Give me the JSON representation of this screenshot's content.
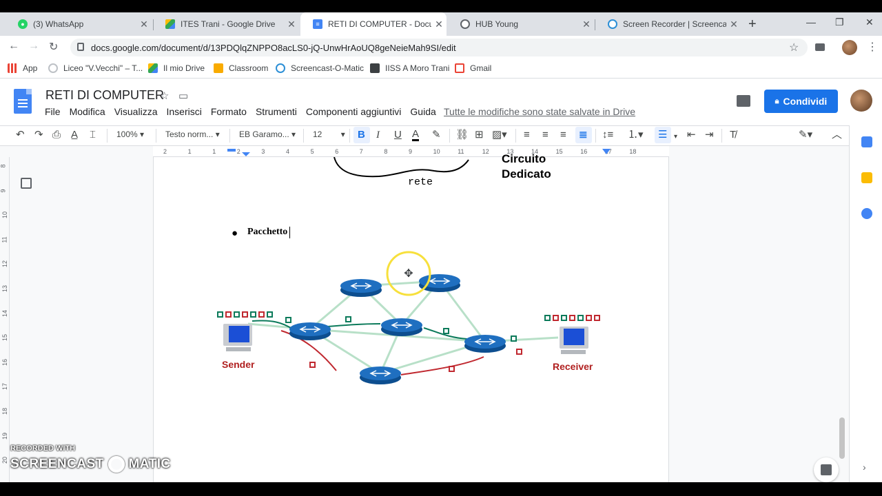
{
  "browser": {
    "tabs": [
      {
        "title": "(3) WhatsApp",
        "icon": "whatsapp-icon",
        "color": "#25d366"
      },
      {
        "title": "ITES Trani - Google Drive",
        "icon": "drive-icon",
        "color": "#fbbc04"
      },
      {
        "title": "RETI DI COMPUTER - Documen",
        "icon": "docs-icon",
        "color": "#4285f4"
      },
      {
        "title": "HUB Young",
        "icon": "globe-icon",
        "color": "#5f6368"
      },
      {
        "title": "Screen Recorder | Screencast-O",
        "icon": "screencast-icon",
        "color": "#2c8fd6"
      }
    ],
    "url": "docs.google.com/document/d/13PDQlqZNPPO8acLS0-jQ-UnwHrAoUQ8geNeieMah9SI/edit",
    "bookmarks": [
      {
        "label": "App",
        "icon": "apps-grid-icon"
      },
      {
        "label": "Liceo \"V.Vecchi\" – T...",
        "icon": "globe-icon"
      },
      {
        "label": "Il mio Drive",
        "icon": "drive-icon"
      },
      {
        "label": "Classroom",
        "icon": "classroom-icon"
      },
      {
        "label": "Screencast-O-Matic",
        "icon": "screencast-icon"
      },
      {
        "label": "IISS A Moro Trani",
        "icon": "school-icon"
      },
      {
        "label": "Gmail",
        "icon": "gmail-icon"
      }
    ]
  },
  "docs": {
    "title": "RETI DI COMPUTER",
    "menu": [
      "File",
      "Modifica",
      "Visualizza",
      "Inserisci",
      "Formato",
      "Strumenti",
      "Componenti aggiuntivi",
      "Guida"
    ],
    "save_status": "Tutte le modifiche sono state salvate in Drive",
    "share_label": "Condividi",
    "toolbar": {
      "zoom": "100%",
      "style": "Testo norm...",
      "font": "EB Garamo...",
      "size": "12"
    },
    "ruler_ticks": [
      "2",
      "1",
      "1",
      "2",
      "3",
      "4",
      "5",
      "6",
      "7",
      "8",
      "9",
      "10",
      "11",
      "12",
      "13",
      "14",
      "15",
      "16",
      "17",
      "18"
    ],
    "vruler_ticks": [
      "8",
      "9",
      "10",
      "11",
      "12",
      "13",
      "14",
      "15",
      "16",
      "17",
      "18",
      "19",
      "20"
    ]
  },
  "content": {
    "circuit_text_line1": "Circuito",
    "circuit_text_line2": "Dedicato",
    "rete_label": "rete",
    "bullet_text": "Pacchetto",
    "diagram": {
      "sender_label": "Sender",
      "receiver_label": "Receiver"
    }
  },
  "watermark": {
    "line1": "RECORDED WITH",
    "line2": "SCREENCAST",
    "line3": "MATIC"
  },
  "colors": {
    "accent": "#1a73e8",
    "docs_blue": "#4285f4",
    "router_blue": "#1f6fc0",
    "packet_green": "#0b7a5a",
    "packet_red": "#c0282f",
    "highlight_yellow": "#f7e03c"
  }
}
